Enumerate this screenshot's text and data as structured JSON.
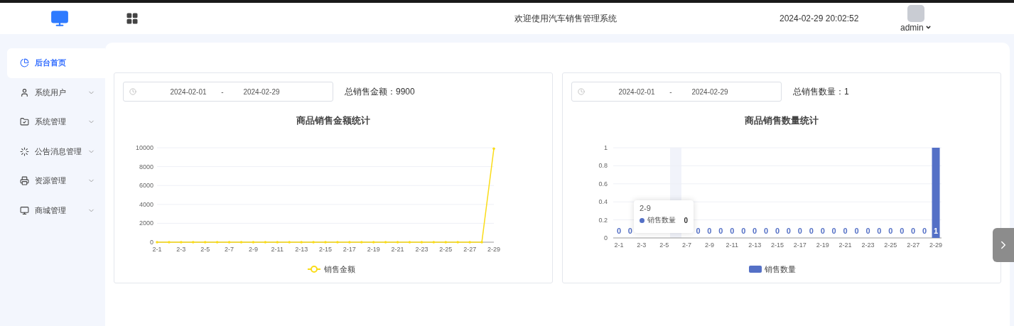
{
  "header": {
    "welcome": "欢迎使用汽车销售管理系统",
    "datetime": "2024-02-29 20:02:52",
    "user": "admin"
  },
  "sidebar": {
    "items": [
      {
        "label": "后台首页",
        "selected": true,
        "expandable": false
      },
      {
        "label": "系统用户",
        "selected": false,
        "expandable": true
      },
      {
        "label": "系统管理",
        "selected": false,
        "expandable": true
      },
      {
        "label": "公告消息管理",
        "selected": false,
        "expandable": true
      },
      {
        "label": "资源管理",
        "selected": false,
        "expandable": true
      },
      {
        "label": "商城管理",
        "selected": false,
        "expandable": true
      }
    ]
  },
  "cards": [
    {
      "date_start": "2024-02-01",
      "date_separator": "-",
      "date_end": "2024-02-29",
      "total": "总销售金额：9900",
      "chart_data": {
        "type": "line",
        "title": "商品销售金额统计",
        "grid": true,
        "categories": [
          "2-1",
          null,
          "2-3",
          null,
          "2-5",
          null,
          "2-7",
          null,
          "2-9",
          null,
          "2-11",
          null,
          "2-13",
          null,
          "2-15",
          null,
          "2-17",
          null,
          "2-19",
          null,
          "2-21",
          null,
          "2-23",
          null,
          "2-25",
          null,
          "2-27",
          null,
          "2-29"
        ],
        "series": [
          {
            "name": "销售金额",
            "color": "#fadc19",
            "values": [
              0,
              0,
              0,
              0,
              0,
              0,
              0,
              0,
              0,
              0,
              0,
              0,
              0,
              0,
              0,
              0,
              0,
              0,
              0,
              0,
              0,
              0,
              0,
              0,
              0,
              0,
              0,
              0,
              9900
            ]
          }
        ],
        "ylim": [
          0,
          10000
        ],
        "yticks": [
          0,
          2000,
          4000,
          6000,
          8000,
          10000
        ]
      }
    },
    {
      "date_start": "2024-02-01",
      "date_separator": "-",
      "date_end": "2024-02-29",
      "total": "总销售数量：1",
      "chart_data": {
        "type": "bar",
        "title": "商品销售数量统计",
        "grid": true,
        "categories": [
          "2-1",
          null,
          "2-3",
          null,
          "2-5",
          null,
          "2-7",
          null,
          "2-9",
          null,
          "2-11",
          null,
          "2-13",
          null,
          "2-15",
          null,
          "2-17",
          null,
          "2-19",
          null,
          "2-21",
          null,
          "2-23",
          null,
          "2-25",
          null,
          "2-27",
          null,
          "2-29"
        ],
        "series": [
          {
            "name": "销售数量",
            "color": "#5470c6",
            "values": [
              0,
              0,
              0,
              0,
              0,
              0,
              0,
              0,
              0,
              0,
              0,
              0,
              0,
              0,
              0,
              0,
              0,
              0,
              0,
              0,
              0,
              0,
              0,
              0,
              0,
              0,
              0,
              0,
              1
            ]
          }
        ],
        "ylim": [
          0,
          1
        ],
        "yticks": [
          0,
          0.2,
          0.4,
          0.6,
          0.8,
          1
        ],
        "value_labels": [
          "0",
          "0",
          null,
          null,
          null,
          null,
          null,
          "0",
          "0",
          "0",
          "0",
          "0",
          "0",
          "0",
          "0",
          "0",
          "0",
          "0",
          "0",
          "0",
          "0",
          "0",
          "0",
          "0",
          "0",
          "0",
          "0",
          "0",
          "1"
        ]
      },
      "tooltip": {
        "title": "2-9",
        "series": "销售数量",
        "value": "0"
      }
    }
  ]
}
